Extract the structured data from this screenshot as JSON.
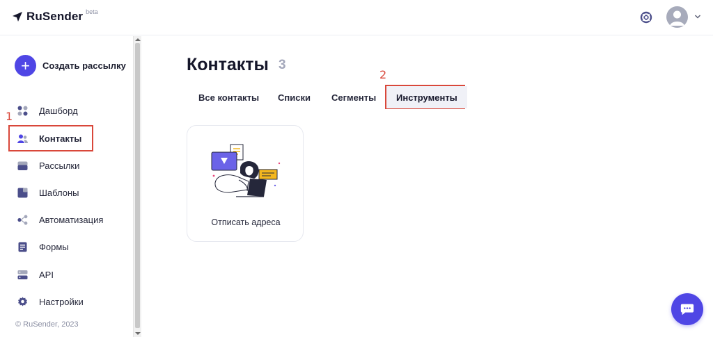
{
  "app": {
    "name": "RuSender",
    "badge": "beta"
  },
  "header": {
    "help_icon": "lifebuoy-icon",
    "avatar_icon": "user-avatar-icon",
    "menu_icon": "chevron-down-icon"
  },
  "sidebar": {
    "create_button": {
      "icon": "plus-icon",
      "label": "Создать рассылку"
    },
    "items": [
      {
        "label": "Дашборд",
        "icon": "dashboard-icon",
        "active": false
      },
      {
        "label": "Контакты",
        "icon": "contacts-icon",
        "active": true
      },
      {
        "label": "Рассылки",
        "icon": "mailings-icon",
        "active": false
      },
      {
        "label": "Шаблоны",
        "icon": "templates-icon",
        "active": false
      },
      {
        "label": "Автоматизация",
        "icon": "automation-icon",
        "active": false
      },
      {
        "label": "Формы",
        "icon": "forms-icon",
        "active": false
      },
      {
        "label": "API",
        "icon": "api-icon",
        "active": false
      },
      {
        "label": "Настройки",
        "icon": "settings-icon",
        "active": false
      }
    ],
    "copyright": "© RuSender, 2023"
  },
  "annotations": {
    "marker_1": "1",
    "marker_2": "2"
  },
  "main": {
    "title": "Контакты",
    "count": "3",
    "tabs": [
      {
        "label": "Все контакты",
        "active": false
      },
      {
        "label": "Списки",
        "active": false
      },
      {
        "label": "Сегменты",
        "active": false
      },
      {
        "label": "Инструменты",
        "active": true
      }
    ],
    "tools": [
      {
        "label": "Отписать адреса",
        "illustration": "person-at-laptop-illustration"
      }
    ]
  },
  "chat": {
    "icon": "chat-bubble-icon"
  },
  "colors": {
    "accent": "#4f46e5",
    "annotation_red": "#d9473a",
    "active_bg": "#eef0ff",
    "icon_purple": "#4b4e8a"
  }
}
